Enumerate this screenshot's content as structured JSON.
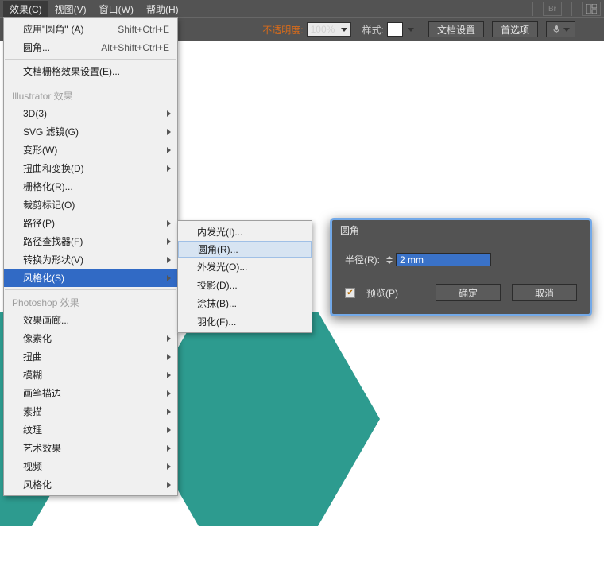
{
  "menubar": {
    "items": [
      "效果(C)",
      "视图(V)",
      "窗口(W)",
      "帮助(H)"
    ],
    "active_index": 0,
    "br_label": "Br"
  },
  "toolbar": {
    "opacity_label": "不透明度:",
    "opacity_value": "100%",
    "style_label": "样式:",
    "doc_setup": "文档设置",
    "prefs": "首选项",
    "mic_icon": "mic"
  },
  "menu": {
    "apply_last": "应用\"圆角\"",
    "apply_last_hint": "(A)",
    "apply_last_shortcut": "Shift+Ctrl+E",
    "round_corners": "圆角...",
    "round_corners_shortcut": "Alt+Shift+Ctrl+E",
    "doc_grid": "文档栅格效果设置(E)...",
    "section_illustrator": "Illustrator 效果",
    "items_ai": [
      {
        "label": "3D(3)",
        "arrow": true
      },
      {
        "label": "SVG 滤镜(G)",
        "arrow": true
      },
      {
        "label": "变形(W)",
        "arrow": true
      },
      {
        "label": "扭曲和变换(D)",
        "arrow": true
      },
      {
        "label": "栅格化(R)...",
        "arrow": false
      },
      {
        "label": "裁剪标记(O)",
        "arrow": false
      },
      {
        "label": "路径(P)",
        "arrow": true
      },
      {
        "label": "路径查找器(F)",
        "arrow": true
      },
      {
        "label": "转换为形状(V)",
        "arrow": true
      },
      {
        "label": "风格化(S)",
        "arrow": true,
        "highlight": true
      }
    ],
    "section_ps": "Photoshop 效果",
    "items_ps": [
      {
        "label": "效果画廊...",
        "arrow": false
      },
      {
        "label": "像素化",
        "arrow": true
      },
      {
        "label": "扭曲",
        "arrow": true
      },
      {
        "label": "模糊",
        "arrow": true
      },
      {
        "label": "画笔描边",
        "arrow": true
      },
      {
        "label": "素描",
        "arrow": true
      },
      {
        "label": "纹理",
        "arrow": true
      },
      {
        "label": "艺术效果",
        "arrow": true
      },
      {
        "label": "视频",
        "arrow": true
      },
      {
        "label": "风格化",
        "arrow": true
      }
    ]
  },
  "submenu": {
    "items": [
      "内发光(I)...",
      "圆角(R)...",
      "外发光(O)...",
      "投影(D)...",
      "涂抹(B)...",
      "羽化(F)..."
    ],
    "highlight_index": 1
  },
  "dialog": {
    "title": "圆角",
    "radius_label": "半径(R):",
    "radius_value": "2 mm",
    "preview_label": "预览(P)",
    "ok": "确定",
    "cancel": "取消"
  }
}
